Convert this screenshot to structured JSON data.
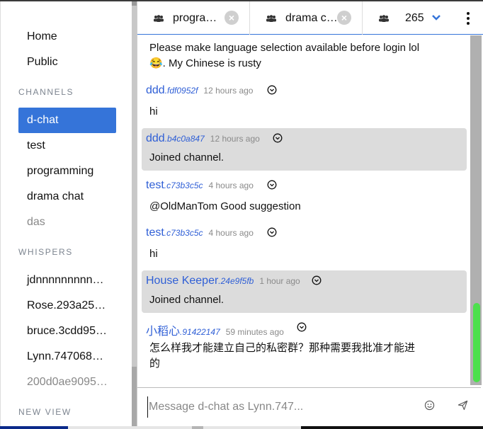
{
  "sidebar": {
    "nav": [
      {
        "label": "Home"
      },
      {
        "label": "Public"
      }
    ],
    "channels_title": "CHANNELS",
    "channels": [
      {
        "label": "d-chat",
        "active": true
      },
      {
        "label": "test"
      },
      {
        "label": "programming"
      },
      {
        "label": "drama chat"
      },
      {
        "label": "das",
        "muted": true
      }
    ],
    "whispers_title": "WHISPERS",
    "whispers": [
      {
        "label": "jdnnnnnnnnn…"
      },
      {
        "label": "Rose.293a25…"
      },
      {
        "label": "bruce.3cdd95…"
      },
      {
        "label": "Lynn.747068…"
      },
      {
        "label": "200d0ae9095…",
        "muted": true
      }
    ],
    "new_view_title": "NEW VIEW"
  },
  "tabs": [
    {
      "icon": "group-icon",
      "label": "progra…",
      "closable": true
    },
    {
      "icon": "group-icon",
      "label": "drama c…",
      "closable": true
    },
    {
      "icon": "group-icon",
      "label": "265",
      "has_dropdown": true
    }
  ],
  "tab_close_glyph": "×",
  "messages": [
    {
      "continuation": true,
      "body": "Please make language selection available before login lol 😂. My Chinese is rusty"
    },
    {
      "user": "ddd",
      "id": ".fdf0952f",
      "time": "12 hours ago",
      "body": "hi",
      "system": false
    },
    {
      "user": "ddd",
      "id": ".b4c0a847",
      "time": "12 hours ago",
      "body": "Joined channel.",
      "system": true
    },
    {
      "user": "test",
      "id": ".c73b3c5c",
      "time": "4 hours ago",
      "body": "@OldManTom Good suggestion",
      "system": false
    },
    {
      "user": "test",
      "id": ".c73b3c5c",
      "time": "4 hours ago",
      "body": "hi",
      "system": false
    },
    {
      "user": "House Keeper",
      "id": ".24e9f5fb",
      "time": "1 hour ago",
      "body": "Joined channel.",
      "system": true
    },
    {
      "user": "小稻心",
      "id": ".91422147",
      "time": "59 minutes ago",
      "body": "怎么样我才能建立自己的私密群？那种需要我批准才能进的",
      "system": false
    }
  ],
  "composer": {
    "placeholder": "Message d-chat as Lynn.747...",
    "value": ""
  },
  "colors": {
    "accent": "#3574d9",
    "username": "#2f5fd6",
    "system_bg": "#dcdcdc",
    "scroll_thumb": "#4ce04c"
  }
}
